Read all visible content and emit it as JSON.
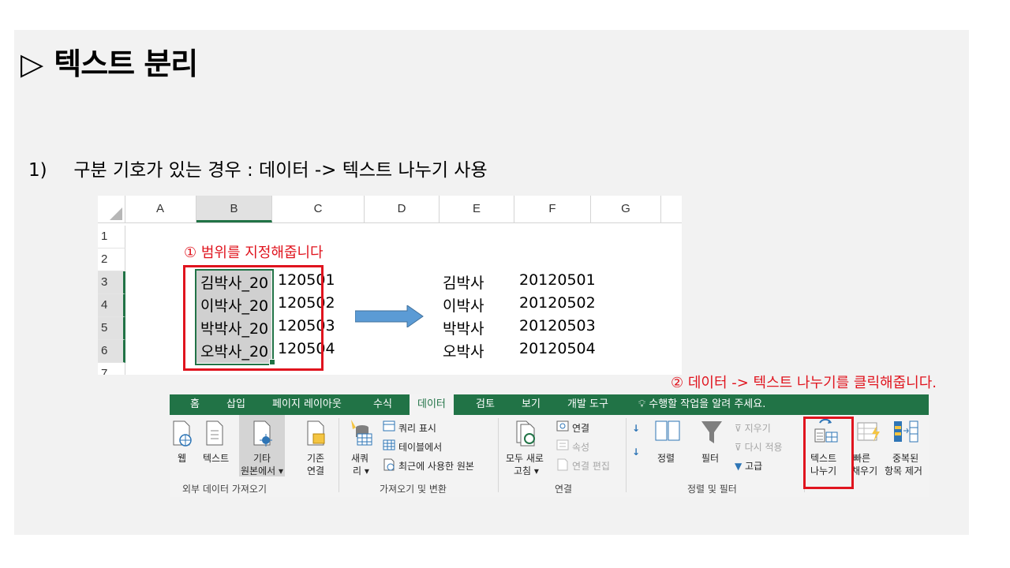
{
  "title": "텍스트 분리",
  "title_marker": "▷",
  "subtitle": {
    "number": "1)",
    "text": "구분 기호가 있는 경우  :  데이터 -> 텍스트 나누기 사용"
  },
  "sheet": {
    "columns": [
      "A",
      "B",
      "C",
      "D",
      "E",
      "F",
      "G"
    ],
    "rows": [
      "1",
      "2",
      "3",
      "4",
      "5",
      "6",
      "7"
    ],
    "source_cells": [
      "김박사_20120501",
      "이박사_20120502",
      "박박사_20120503",
      "오박사_20120504"
    ],
    "source_left": [
      "김박사_20",
      "이박사_20",
      "박박사_20",
      "오박사_20"
    ],
    "source_right": [
      "120501",
      "120502",
      "120503",
      "120504"
    ],
    "names": [
      "김박사",
      "이박사",
      "박박사",
      "오박사"
    ],
    "numbers": [
      "20120501",
      "20120502",
      "20120503",
      "20120504"
    ]
  },
  "annotation1": "① 범위를 지정해줍니다",
  "annotation2": "② 데이터 -> 텍스트 나누기를 클릭해줍니다.",
  "ribbon": {
    "tabs": [
      "홈",
      "삽입",
      "페이지 레이아웃",
      "수식",
      "데이터",
      "검토",
      "보기",
      "개발 도구"
    ],
    "active_tab": "데이터",
    "tell_me": "수행할 작업을 알려 주세요.",
    "buttons": {
      "web": "웹",
      "text": "텍스트",
      "other_sources_1": "기타",
      "other_sources_2": "원본에서 ▾",
      "existing_1": "기존",
      "existing_2": "연결",
      "new_query_1": "새쿼",
      "new_query_2": "리 ▾",
      "show_queries": "쿼리 표시",
      "from_table": "테이블에서",
      "recent_sources": "최근에 사용한 원본",
      "refresh_all_1": "모두 새로",
      "refresh_all_2": "고침 ▾",
      "connections": "연결",
      "properties": "속성",
      "edit_links": "연결 편집",
      "sort": "정렬",
      "filter": "필터",
      "clear": "지우기",
      "reapply": "다시 적용",
      "advanced": "고급",
      "text_to_columns_1": "텍스트",
      "text_to_columns_2": "나누기",
      "flash_fill_1": "빠른",
      "flash_fill_2": "채우기",
      "remove_dup_1": "중복된",
      "remove_dup_2": "항목 제거"
    },
    "groups": [
      "외부 데이터 가져오기",
      "가져오기 및 변환",
      "연결",
      "정렬 및 필터"
    ]
  },
  "colors": {
    "excel_green": "#217346",
    "annotation_red": "#e0141e",
    "arrow_blue": "#5b9bd5"
  }
}
